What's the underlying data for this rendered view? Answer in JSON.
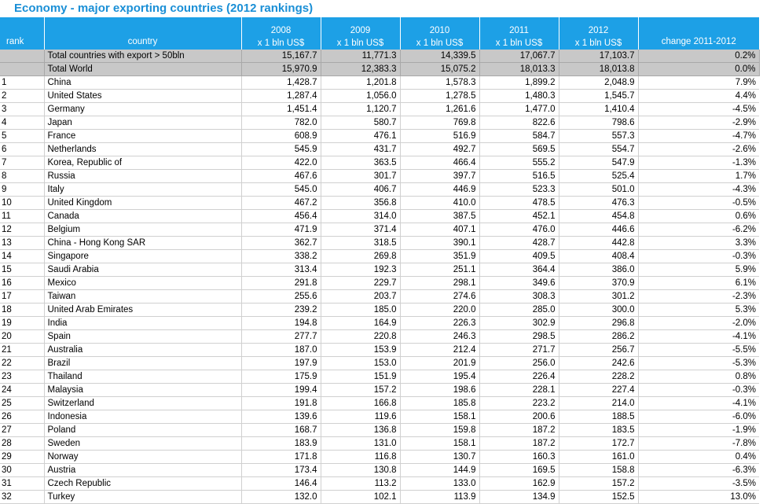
{
  "title": "Economy - major exporting countries (2012 rankings)",
  "header": {
    "rank": "rank",
    "country": "country",
    "years": [
      {
        "year": "2008",
        "unit": "x 1 bln US$"
      },
      {
        "year": "2009",
        "unit": "x 1 bln US$"
      },
      {
        "year": "2010",
        "unit": "x 1 bln US$"
      },
      {
        "year": "2011",
        "unit": "x 1 bln US$"
      },
      {
        "year": "2012",
        "unit": "x 1 bln US$"
      }
    ],
    "change": "change 2011-2012"
  },
  "summary_rows": [
    {
      "rank": "",
      "country": "Total countries with export > 50bln",
      "v": [
        "15,167.7",
        "11,771.3",
        "14,339.5",
        "17,067.7",
        "17,103.7"
      ],
      "change": "0.2%"
    },
    {
      "rank": "",
      "country": "Total World",
      "v": [
        "15,970.9",
        "12,383.3",
        "15,075.2",
        "18,013.3",
        "18,013.8"
      ],
      "change": "0.0%"
    }
  ],
  "rows": [
    {
      "rank": "1",
      "country": "China",
      "v": [
        "1,428.7",
        "1,201.8",
        "1,578.3",
        "1,899.2",
        "2,048.9"
      ],
      "change": "7.9%"
    },
    {
      "rank": "2",
      "country": "United States",
      "v": [
        "1,287.4",
        "1,056.0",
        "1,278.5",
        "1,480.3",
        "1,545.7"
      ],
      "change": "4.4%"
    },
    {
      "rank": "3",
      "country": "Germany",
      "v": [
        "1,451.4",
        "1,120.7",
        "1,261.6",
        "1,477.0",
        "1,410.4"
      ],
      "change": "-4.5%"
    },
    {
      "rank": "4",
      "country": "Japan",
      "v": [
        "782.0",
        "580.7",
        "769.8",
        "822.6",
        "798.6"
      ],
      "change": "-2.9%"
    },
    {
      "rank": "5",
      "country": "France",
      "v": [
        "608.9",
        "476.1",
        "516.9",
        "584.7",
        "557.3"
      ],
      "change": "-4.7%"
    },
    {
      "rank": "6",
      "country": "Netherlands",
      "v": [
        "545.9",
        "431.7",
        "492.7",
        "569.5",
        "554.7"
      ],
      "change": "-2.6%"
    },
    {
      "rank": "7",
      "country": "Korea, Republic of",
      "v": [
        "422.0",
        "363.5",
        "466.4",
        "555.2",
        "547.9"
      ],
      "change": "-1.3%"
    },
    {
      "rank": "8",
      "country": "Russia",
      "v": [
        "467.6",
        "301.7",
        "397.7",
        "516.5",
        "525.4"
      ],
      "change": "1.7%"
    },
    {
      "rank": "9",
      "country": "Italy",
      "v": [
        "545.0",
        "406.7",
        "446.9",
        "523.3",
        "501.0"
      ],
      "change": "-4.3%"
    },
    {
      "rank": "10",
      "country": "United Kingdom",
      "v": [
        "467.2",
        "356.8",
        "410.0",
        "478.5",
        "476.3"
      ],
      "change": "-0.5%"
    },
    {
      "rank": "11",
      "country": "Canada",
      "v": [
        "456.4",
        "314.0",
        "387.5",
        "452.1",
        "454.8"
      ],
      "change": "0.6%"
    },
    {
      "rank": "12",
      "country": "Belgium",
      "v": [
        "471.9",
        "371.4",
        "407.1",
        "476.0",
        "446.6"
      ],
      "change": "-6.2%"
    },
    {
      "rank": "13",
      "country": "China - Hong Kong SAR",
      "v": [
        "362.7",
        "318.5",
        "390.1",
        "428.7",
        "442.8"
      ],
      "change": "3.3%"
    },
    {
      "rank": "14",
      "country": "Singapore",
      "v": [
        "338.2",
        "269.8",
        "351.9",
        "409.5",
        "408.4"
      ],
      "change": "-0.3%"
    },
    {
      "rank": "15",
      "country": "Saudi Arabia",
      "v": [
        "313.4",
        "192.3",
        "251.1",
        "364.4",
        "386.0"
      ],
      "change": "5.9%"
    },
    {
      "rank": "16",
      "country": "Mexico",
      "v": [
        "291.8",
        "229.7",
        "298.1",
        "349.6",
        "370.9"
      ],
      "change": "6.1%"
    },
    {
      "rank": "17",
      "country": "Taiwan",
      "v": [
        "255.6",
        "203.7",
        "274.6",
        "308.3",
        "301.2"
      ],
      "change": "-2.3%"
    },
    {
      "rank": "18",
      "country": "United Arab Emirates",
      "v": [
        "239.2",
        "185.0",
        "220.0",
        "285.0",
        "300.0"
      ],
      "change": "5.3%"
    },
    {
      "rank": "19",
      "country": "India",
      "v": [
        "194.8",
        "164.9",
        "226.3",
        "302.9",
        "296.8"
      ],
      "change": "-2.0%"
    },
    {
      "rank": "20",
      "country": "Spain",
      "v": [
        "277.7",
        "220.8",
        "246.3",
        "298.5",
        "286.2"
      ],
      "change": "-4.1%"
    },
    {
      "rank": "21",
      "country": "Australia",
      "v": [
        "187.0",
        "153.9",
        "212.4",
        "271.7",
        "256.7"
      ],
      "change": "-5.5%"
    },
    {
      "rank": "22",
      "country": "Brazil",
      "v": [
        "197.9",
        "153.0",
        "201.9",
        "256.0",
        "242.6"
      ],
      "change": "-5.3%"
    },
    {
      "rank": "23",
      "country": "Thailand",
      "v": [
        "175.9",
        "151.9",
        "195.4",
        "226.4",
        "228.2"
      ],
      "change": "0.8%"
    },
    {
      "rank": "24",
      "country": "Malaysia",
      "v": [
        "199.4",
        "157.2",
        "198.6",
        "228.1",
        "227.4"
      ],
      "change": "-0.3%"
    },
    {
      "rank": "25",
      "country": "Switzerland",
      "v": [
        "191.8",
        "166.8",
        "185.8",
        "223.2",
        "214.0"
      ],
      "change": "-4.1%"
    },
    {
      "rank": "26",
      "country": "Indonesia",
      "v": [
        "139.6",
        "119.6",
        "158.1",
        "200.6",
        "188.5"
      ],
      "change": "-6.0%"
    },
    {
      "rank": "27",
      "country": "Poland",
      "v": [
        "168.7",
        "136.8",
        "159.8",
        "187.2",
        "183.5"
      ],
      "change": "-1.9%"
    },
    {
      "rank": "28",
      "country": "Sweden",
      "v": [
        "183.9",
        "131.0",
        "158.1",
        "187.2",
        "172.7"
      ],
      "change": "-7.8%"
    },
    {
      "rank": "29",
      "country": "Norway",
      "v": [
        "171.8",
        "116.8",
        "130.7",
        "160.3",
        "161.0"
      ],
      "change": "0.4%"
    },
    {
      "rank": "30",
      "country": "Austria",
      "v": [
        "173.4",
        "130.8",
        "144.9",
        "169.5",
        "158.8"
      ],
      "change": "-6.3%"
    },
    {
      "rank": "31",
      "country": "Czech Republic",
      "v": [
        "146.4",
        "113.2",
        "133.0",
        "162.9",
        "157.2"
      ],
      "change": "-3.5%"
    },
    {
      "rank": "32",
      "country": "Turkey",
      "v": [
        "132.0",
        "102.1",
        "113.9",
        "134.9",
        "152.5"
      ],
      "change": "13.0%"
    }
  ]
}
